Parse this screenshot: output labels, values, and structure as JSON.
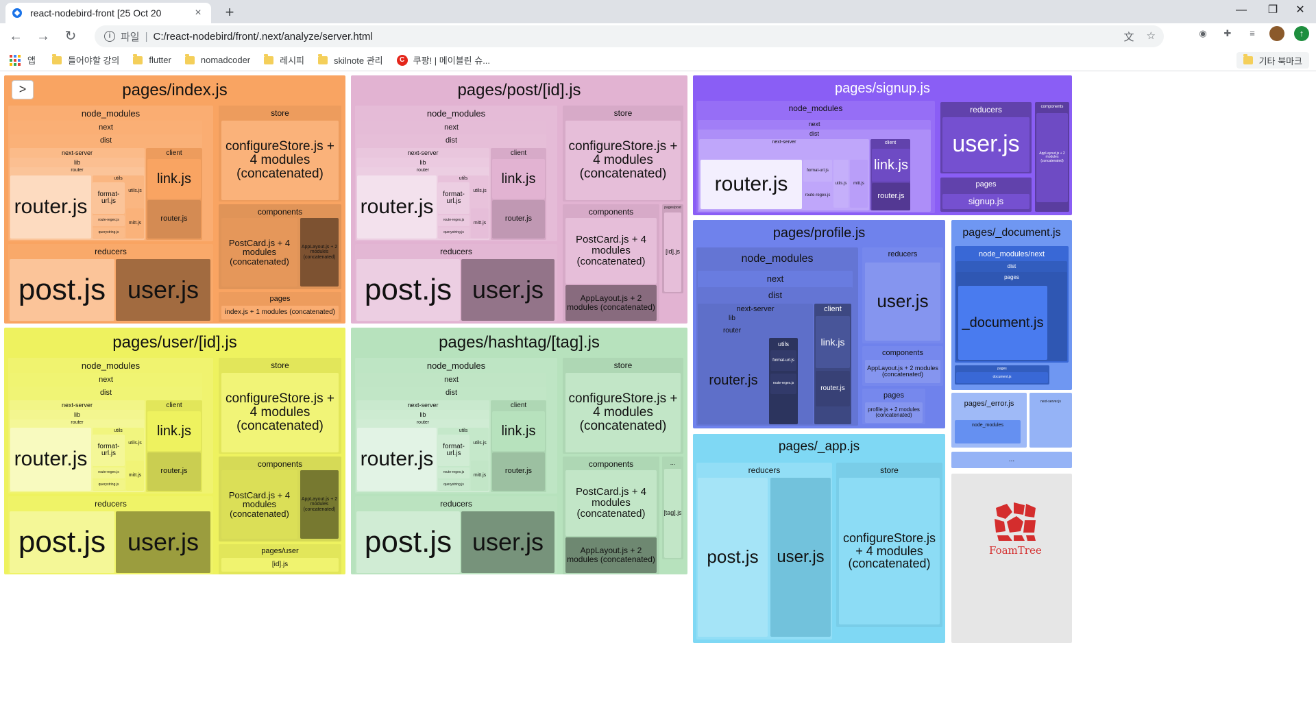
{
  "browser": {
    "tab_title": "react-nodebird-front [25 Oct 20",
    "tab_close": "×",
    "new_tab": "+",
    "url_scheme": "파일",
    "url": "C:/react-nodebird/front/.next/analyze/server.html",
    "win_min": "—",
    "win_max": "❐",
    "win_close": "✕"
  },
  "bookmarks": {
    "apps": "앱",
    "items": [
      "들어야할 강의",
      "flutter",
      "nomadcoder",
      "레시피",
      "skilnote 관리",
      "쿠팡! | 메이블린 슈..."
    ],
    "other": "기타 북마크"
  },
  "treemap": {
    "toggle": ">",
    "groups": {
      "index": {
        "title": "pages/index.js",
        "node_modules": "node_modules",
        "next": "next",
        "dist": "dist",
        "next_server": "next-server",
        "lib": "lib",
        "router_dir": "router",
        "router_js": "router.js",
        "utils": "utils",
        "format_url": "format-url.js",
        "route_regex": "route-regex.js",
        "querystring": "querystring.js",
        "utils_js": "utils.js",
        "mitt": "mitt.js",
        "client": "client",
        "link": "link.js",
        "client_router": "router.js",
        "store": "store",
        "configure": "configureStore.js + 4 modules (concatenated)",
        "components": "components",
        "postcard": "PostCard.js + 4 modules (concatenated)",
        "applayout": "AppLayout.js + 2 modules (concatenated)",
        "reducers": "reducers",
        "post": "post.js",
        "user": "user.js",
        "pages": "pages",
        "pages_entry": "index.js + 1 modules (concatenated)"
      },
      "post": {
        "title": "pages/post/[id].js",
        "node_modules": "node_modules",
        "next": "next",
        "dist": "dist",
        "next_server": "next-server",
        "lib": "lib",
        "router_dir": "router",
        "router_js": "router.js",
        "utils": "utils",
        "format_url": "format-url.js",
        "route_regex": "route-regex.js",
        "querystring": "querystring.js",
        "utils_js": "utils.js",
        "mitt": "mitt.js",
        "client": "client",
        "link": "link.js",
        "client_router": "router.js",
        "store": "store",
        "configure": "configureStore.js + 4 modules (concatenated)",
        "components": "components",
        "postcard": "PostCard.js + 4 modules (concatenated)",
        "applayout": "AppLayout.js + 2 modules (concatenated)",
        "reducers": "reducers",
        "post": "post.js",
        "user": "user.js",
        "pages_post": "pages/post",
        "id": "[id].js"
      },
      "signup": {
        "title": "pages/signup.js",
        "node_modules": "node_modules",
        "next": "next",
        "dist": "dist",
        "next_server": "next-server",
        "lib": "lib",
        "router_dir": "router",
        "router_js": "router.js",
        "format_url": "format-url.js",
        "route_regex": "route-regex.js",
        "utils_js": "utils.js",
        "mitt": "mitt.js",
        "client": "client",
        "link": "link.js",
        "client_router": "router.js",
        "reducers": "reducers",
        "user": "user.js",
        "pages": "pages",
        "signup": "signup.js",
        "components": "components",
        "applayout": "AppLayout.js + 2 modules (concatenated)"
      },
      "user": {
        "title": "pages/user/[id].js",
        "node_modules": "node_modules",
        "next": "next",
        "dist": "dist",
        "next_server": "next-server",
        "lib": "lib",
        "router_dir": "router",
        "router_js": "router.js",
        "utils": "utils",
        "format_url": "format-url.js",
        "route_regex": "route-regex.js",
        "querystring": "querystring.js",
        "utils_js": "utils.js",
        "mitt": "mitt.js",
        "client": "client",
        "link": "link.js",
        "client_router": "router.js",
        "store": "store",
        "configure": "configureStore.js + 4 modules (concatenated)",
        "components": "components",
        "postcard": "PostCard.js + 4 modules (concatenated)",
        "applayout": "AppLayout.js + 2 modules (concatenated)",
        "reducers": "reducers",
        "post": "post.js",
        "user": "user.js",
        "pages_user": "pages/user",
        "id": "[id].js"
      },
      "hashtag": {
        "title": "pages/hashtag/[tag].js",
        "node_modules": "node_modules",
        "next": "next",
        "dist": "dist",
        "next_server": "next-server",
        "lib": "lib",
        "router_dir": "router",
        "router_js": "router.js",
        "utils": "utils",
        "format_url": "format-url.js",
        "route_regex": "route-regex.js",
        "querystring": "querystring.js",
        "utils_js": "utils.js",
        "mitt": "mitt.js",
        "client": "client",
        "link": "link.js",
        "client_router": "router.js",
        "store": "store",
        "configure": "configureStore.js + 4 modules (concatenated)",
        "components": "components",
        "postcard": "PostCard.js + 4 modules (concatenated)",
        "applayout": "AppLayout.js + 2 modules (concatenated)",
        "reducers": "reducers",
        "post": "post.js",
        "user": "user.js",
        "tag": "[tag].js"
      },
      "profile": {
        "title": "pages/profile.js",
        "node_modules": "node_modules",
        "next": "next",
        "dist": "dist",
        "next_server": "next-server",
        "lib": "lib",
        "router_dir": "router",
        "router_js": "router.js",
        "utils": "utils",
        "format_url": "format-url.js",
        "route_regex": "route-regex.js",
        "client": "client",
        "link": "link.js",
        "client_router": "router.js",
        "reducers": "reducers",
        "user": "user.js",
        "components": "components",
        "applayout": "AppLayout.js + 2 modules (concatenated)",
        "pages": "pages",
        "profile_entry": "profile.js + 2 modules (concatenated)"
      },
      "document": {
        "title": "pages/_document.js",
        "node_modules_next": "node_modules/next",
        "dist": "dist",
        "pages": "pages",
        "document": "_document.js",
        "pages_small": "pages",
        "document_small": "document.js"
      },
      "app": {
        "title": "pages/_app.js",
        "reducers": "reducers",
        "post": "post.js",
        "user": "user.js",
        "store": "store",
        "configure": "configureStore.js + 4 modules (concatenated)"
      },
      "error": {
        "title": "pages/_error.js",
        "node_modules": "node_modules"
      },
      "next_server_small": {
        "title": "next-server.js"
      },
      "ellipsis": "...",
      "foamtree": "FoamTree"
    }
  },
  "colors": {
    "index": "#f9a462",
    "post": "#e2b3d2",
    "signup": "#8a5ef5",
    "user": "#eef25f",
    "hashtag": "#b7e2bd",
    "profile": "#6f82ec",
    "document": "#3f74ee",
    "app": "#7fd8f4"
  }
}
